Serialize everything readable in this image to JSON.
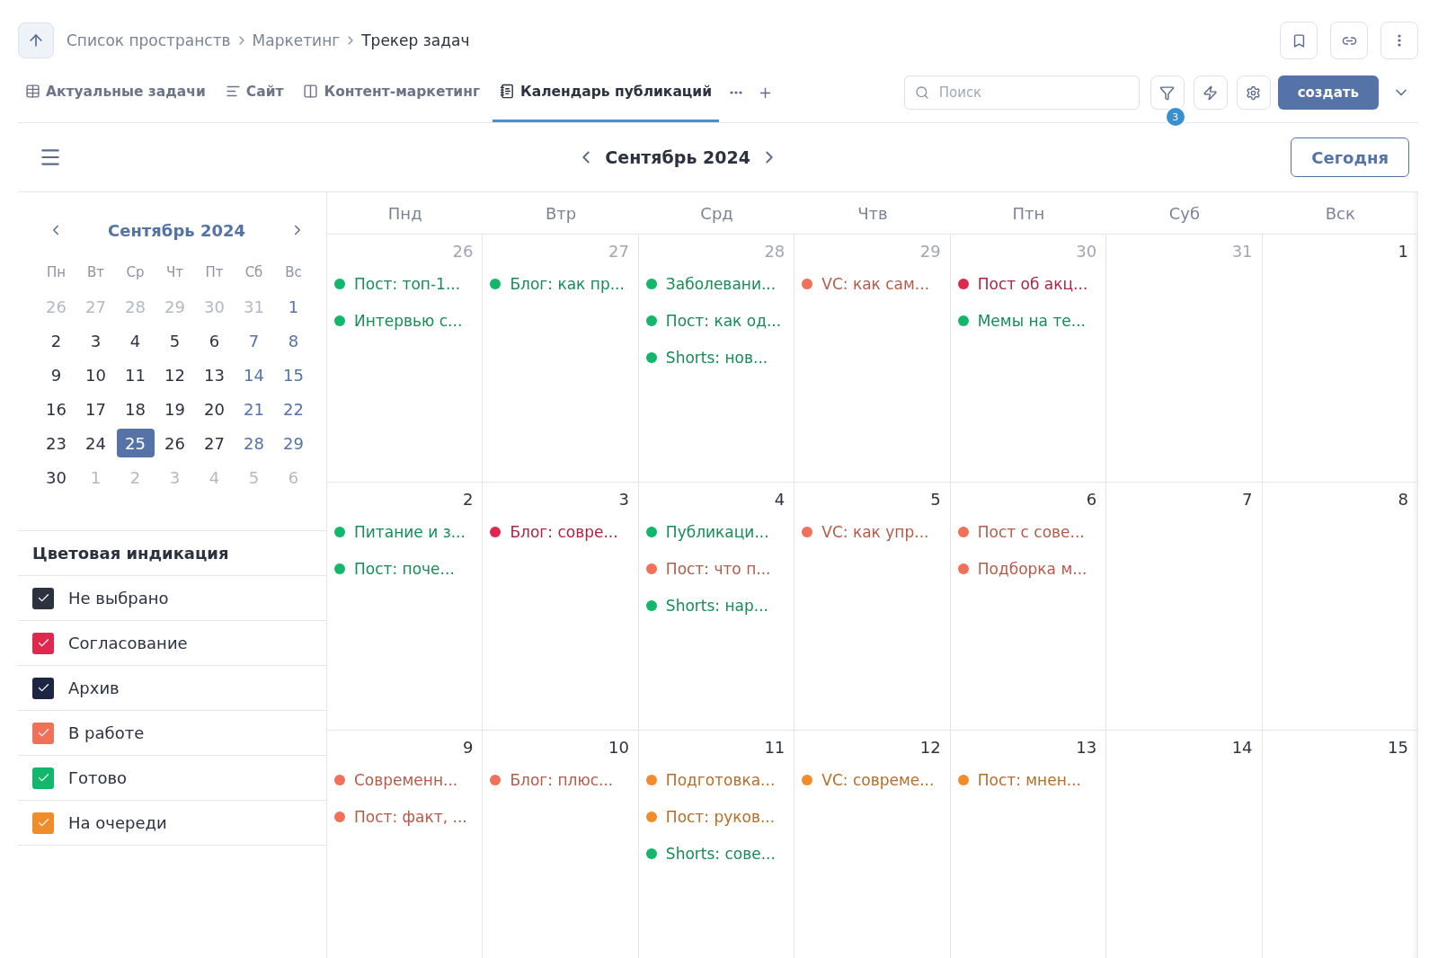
{
  "breadcrumbs": [
    {
      "label": "Список пространств"
    },
    {
      "label": "Маркетинг"
    },
    {
      "label": "Трекер задач"
    }
  ],
  "tabs": [
    {
      "label": "Актуальные задачи",
      "kind": "table",
      "selected": false
    },
    {
      "label": "Сайт",
      "kind": "list",
      "selected": false
    },
    {
      "label": "Контент-маркетинг",
      "kind": "board",
      "selected": false
    },
    {
      "label": "Календарь публикаций",
      "kind": "calendar",
      "selected": true
    }
  ],
  "search": {
    "placeholder": "Поиск"
  },
  "filter_badge": "3",
  "create_button": "создать",
  "month_title": "Сентябрь 2024",
  "today_button": "Сегодня",
  "mini_calendar": {
    "title": "Сентябрь 2024",
    "weekdays": [
      "Пн",
      "Вт",
      "Ср",
      "Чт",
      "Пт",
      "Сб",
      "Вс"
    ],
    "days": [
      {
        "label": "26",
        "kind": "other",
        "selected": false
      },
      {
        "label": "27",
        "kind": "other",
        "selected": false
      },
      {
        "label": "28",
        "kind": "other",
        "selected": false
      },
      {
        "label": "29",
        "kind": "other",
        "selected": false
      },
      {
        "label": "30",
        "kind": "other",
        "selected": false
      },
      {
        "label": "31",
        "kind": "other",
        "selected": false
      },
      {
        "label": "1",
        "kind": "weekend",
        "selected": false
      },
      {
        "label": "2",
        "kind": "weekday",
        "selected": false
      },
      {
        "label": "3",
        "kind": "weekday",
        "selected": false
      },
      {
        "label": "4",
        "kind": "weekday",
        "selected": false
      },
      {
        "label": "5",
        "kind": "weekday",
        "selected": false
      },
      {
        "label": "6",
        "kind": "weekday",
        "selected": false
      },
      {
        "label": "7",
        "kind": "weekend",
        "selected": false
      },
      {
        "label": "8",
        "kind": "weekend",
        "selected": false
      },
      {
        "label": "9",
        "kind": "weekday",
        "selected": false
      },
      {
        "label": "10",
        "kind": "weekday",
        "selected": false
      },
      {
        "label": "11",
        "kind": "weekday",
        "selected": false
      },
      {
        "label": "12",
        "kind": "weekday",
        "selected": false
      },
      {
        "label": "13",
        "kind": "weekday",
        "selected": false
      },
      {
        "label": "14",
        "kind": "weekend",
        "selected": false
      },
      {
        "label": "15",
        "kind": "weekend",
        "selected": false
      },
      {
        "label": "16",
        "kind": "weekday",
        "selected": false
      },
      {
        "label": "17",
        "kind": "weekday",
        "selected": false
      },
      {
        "label": "18",
        "kind": "weekday",
        "selected": false
      },
      {
        "label": "19",
        "kind": "weekday",
        "selected": false
      },
      {
        "label": "20",
        "kind": "weekday",
        "selected": false
      },
      {
        "label": "21",
        "kind": "weekend",
        "selected": false
      },
      {
        "label": "22",
        "kind": "weekend",
        "selected": false
      },
      {
        "label": "23",
        "kind": "weekday",
        "selected": false
      },
      {
        "label": "24",
        "kind": "weekday",
        "selected": false
      },
      {
        "label": "25",
        "kind": "weekday",
        "selected": true
      },
      {
        "label": "26",
        "kind": "weekday",
        "selected": false
      },
      {
        "label": "27",
        "kind": "weekday",
        "selected": false
      },
      {
        "label": "28",
        "kind": "weekend",
        "selected": false
      },
      {
        "label": "29",
        "kind": "weekend",
        "selected": false
      },
      {
        "label": "30",
        "kind": "weekday",
        "selected": false
      },
      {
        "label": "1",
        "kind": "other",
        "selected": false
      },
      {
        "label": "2",
        "kind": "other",
        "selected": false
      },
      {
        "label": "3",
        "kind": "other",
        "selected": false
      },
      {
        "label": "4",
        "kind": "other",
        "selected": false
      },
      {
        "label": "5",
        "kind": "other",
        "selected": false
      },
      {
        "label": "6",
        "kind": "other",
        "selected": false
      }
    ]
  },
  "legend": {
    "title": "Цветовая индикация",
    "items": [
      {
        "label": "Не выбрано",
        "color": "#2d3240",
        "checked": true
      },
      {
        "label": "Согласование",
        "color": "#e0284f",
        "checked": true
      },
      {
        "label": "Архив",
        "color": "#1c2541",
        "checked": true
      },
      {
        "label": "В работе",
        "color": "#f0705a",
        "checked": true
      },
      {
        "label": "Готово",
        "color": "#12b76a",
        "checked": true
      },
      {
        "label": "На очереди",
        "color": "#f08c2a",
        "checked": true
      }
    ]
  },
  "weekdays": [
    "Пнд",
    "Втр",
    "Срд",
    "Чтв",
    "Птн",
    "Суб",
    "Вск"
  ],
  "weeks": [
    [
      {
        "number": "26",
        "muted": true,
        "events": [
          {
            "title": "Пост: топ-1...",
            "color": "#12b76a"
          },
          {
            "title": "Интервью с...",
            "color": "#12b76a"
          }
        ]
      },
      {
        "number": "27",
        "muted": true,
        "events": [
          {
            "title": "Блог: как пр...",
            "color": "#12b76a"
          }
        ]
      },
      {
        "number": "28",
        "muted": true,
        "events": [
          {
            "title": "Заболевани...",
            "color": "#12b76a"
          },
          {
            "title": "Пост: как од...",
            "color": "#12b76a"
          },
          {
            "title": "Shorts: нов...",
            "color": "#12b76a"
          }
        ]
      },
      {
        "number": "29",
        "muted": true,
        "events": [
          {
            "title": "VC: как сам...",
            "color": "#f0705a"
          }
        ]
      },
      {
        "number": "30",
        "muted": true,
        "events": [
          {
            "title": "Пост об акц...",
            "color": "#e0284f"
          },
          {
            "title": "Мемы на те...",
            "color": "#12b76a"
          }
        ]
      },
      {
        "number": "31",
        "muted": true
      },
      {
        "number": "1",
        "muted": false
      }
    ],
    [
      {
        "number": "2",
        "muted": false,
        "events": [
          {
            "title": "Питание и з...",
            "color": "#12b76a"
          },
          {
            "title": "Пост: поче...",
            "color": "#12b76a"
          }
        ]
      },
      {
        "number": "3",
        "muted": false,
        "events": [
          {
            "title": "Блог: совре...",
            "color": "#e0284f"
          }
        ]
      },
      {
        "number": "4",
        "muted": false,
        "events": [
          {
            "title": "Публикаци...",
            "color": "#12b76a"
          },
          {
            "title": "Пост: что п...",
            "color": "#f0705a"
          },
          {
            "title": "Shorts: нар...",
            "color": "#12b76a"
          }
        ]
      },
      {
        "number": "5",
        "muted": false,
        "events": [
          {
            "title": "VC: как упр...",
            "color": "#f0705a"
          }
        ]
      },
      {
        "number": "6",
        "muted": false,
        "events": [
          {
            "title": "Пост с сове...",
            "color": "#f0705a"
          },
          {
            "title": "Подборка м...",
            "color": "#f0705a"
          }
        ]
      },
      {
        "number": "7",
        "muted": false
      },
      {
        "number": "8",
        "muted": false
      }
    ],
    [
      {
        "number": "9",
        "muted": false,
        "events": [
          {
            "title": "Современн...",
            "color": "#f0705a"
          },
          {
            "title": "Пост: факт, ...",
            "color": "#f0705a"
          }
        ]
      },
      {
        "number": "10",
        "muted": false,
        "events": [
          {
            "title": "Блог: плюс...",
            "color": "#f0705a"
          }
        ]
      },
      {
        "number": "11",
        "muted": false,
        "events": [
          {
            "title": "Подготовка...",
            "color": "#f08c2a"
          },
          {
            "title": "Пост: руков...",
            "color": "#f08c2a"
          },
          {
            "title": "Shorts: сове...",
            "color": "#12b76a"
          }
        ]
      },
      {
        "number": "12",
        "muted": false,
        "events": [
          {
            "title": "VC: совреме...",
            "color": "#f08c2a"
          }
        ]
      },
      {
        "number": "13",
        "muted": false,
        "events": [
          {
            "title": "Пост: мнен...",
            "color": "#f08c2a"
          }
        ]
      },
      {
        "number": "14",
        "muted": false
      },
      {
        "number": "15",
        "muted": false
      }
    ]
  ]
}
